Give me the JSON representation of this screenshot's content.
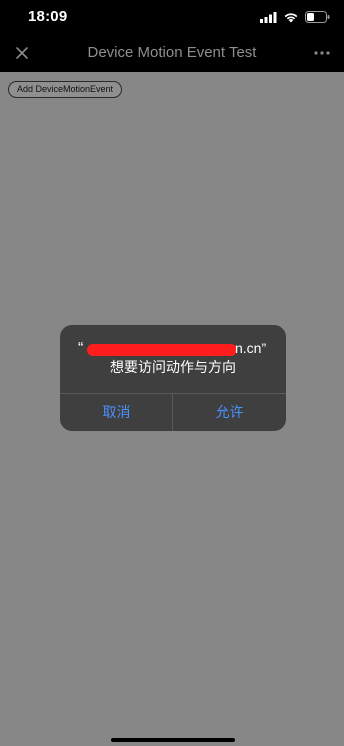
{
  "status_bar": {
    "time": "18:09",
    "icons": [
      "signal-icon",
      "wifi-icon",
      "battery-icon"
    ]
  },
  "nav": {
    "title": "Device Motion Event Test",
    "left_icon": "close-icon",
    "right_icon": "more-icon"
  },
  "content": {
    "button_label": "Add DeviceMotionEvent"
  },
  "alert": {
    "quote_open": "“",
    "domain_suffix": "n.cn”",
    "message": "想要访问动作与方向",
    "cancel_label": "取消",
    "allow_label": "允许"
  },
  "colors": {
    "background": "#878787",
    "bars": "#000000",
    "alert_bg": "#3f3f3f",
    "accent": "#4a90ff",
    "redaction": "#ff1e1e"
  }
}
